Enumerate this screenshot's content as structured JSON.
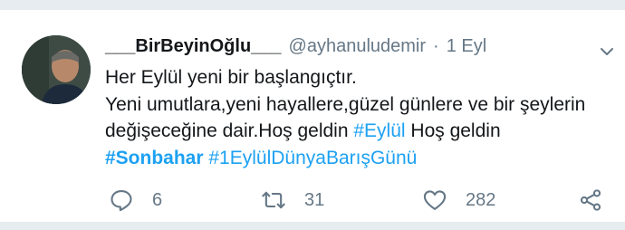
{
  "tweet": {
    "display_name": "___BirBeyinOğlu___",
    "handle": "@ayhanuludemir",
    "separator": "·",
    "time": "1 Eyl",
    "text_line1": "Her Eylül yeni bir başlangıçtır.",
    "text_line2a": "Yeni umutlara,yeni hayallere,güzel günlere ve bir şeylerin değişeceğine dair.Hoş geldin ",
    "hashtag_eylul": "#Eylül",
    "text_hos": " Hoş geldin ",
    "hashtag_sonbahar": "#Sonbahar",
    "text_space": " ",
    "hashtag_baris": "#1EylülDünyaBarışGünü",
    "replies": "6",
    "retweets": "31",
    "likes": "282"
  },
  "icons": {
    "reply": "reply-icon",
    "retweet": "retweet-icon",
    "like": "heart-icon",
    "share": "share-icon",
    "caret": "chevron-down-icon"
  },
  "colors": {
    "accent": "#1da1f2",
    "text": "#14171a",
    "muted": "#657786",
    "border": "#e6ecf0"
  }
}
